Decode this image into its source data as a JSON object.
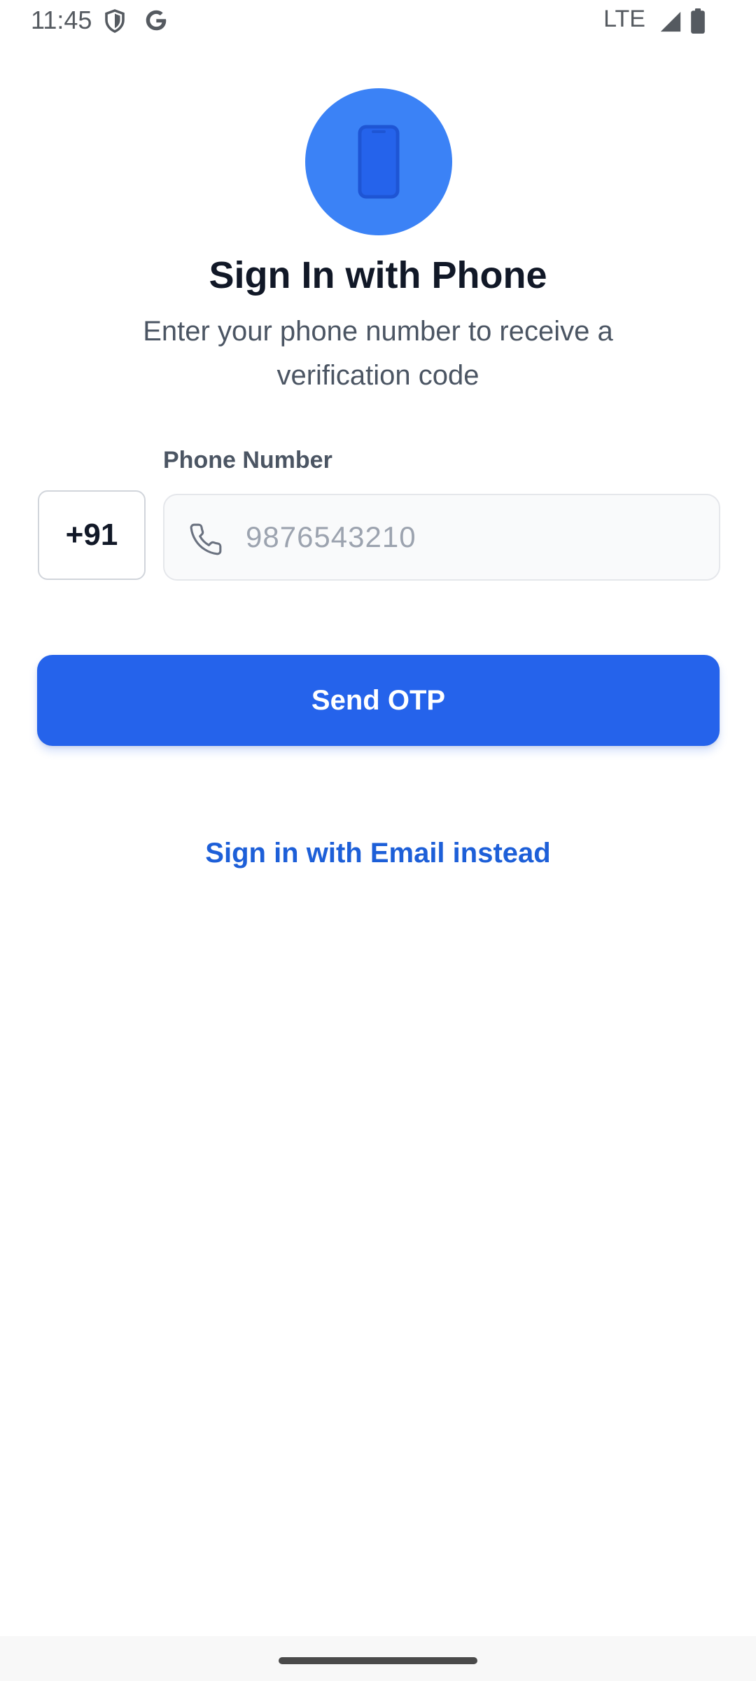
{
  "status_bar": {
    "time": "11:45",
    "network": "LTE",
    "icons": [
      "shield-icon",
      "google-icon",
      "signal-icon",
      "battery-icon"
    ]
  },
  "hero": {
    "icon": "smartphone-icon",
    "circle_color": "#3b82f6"
  },
  "header": {
    "title": "Sign In with Phone",
    "subtitle": "Enter your phone number to receive a verification code"
  },
  "form": {
    "phone_label": "Phone Number",
    "country_code": "+91",
    "phone_placeholder": "9876543210",
    "phone_value": "",
    "phone_icon": "phone-icon"
  },
  "actions": {
    "send_otp_label": "Send OTP",
    "email_link_label": "Sign in with Email instead"
  },
  "colors": {
    "primary": "#2563eb",
    "title_text": "#111827",
    "muted_text": "#4b5563",
    "placeholder": "#9ca3af"
  }
}
